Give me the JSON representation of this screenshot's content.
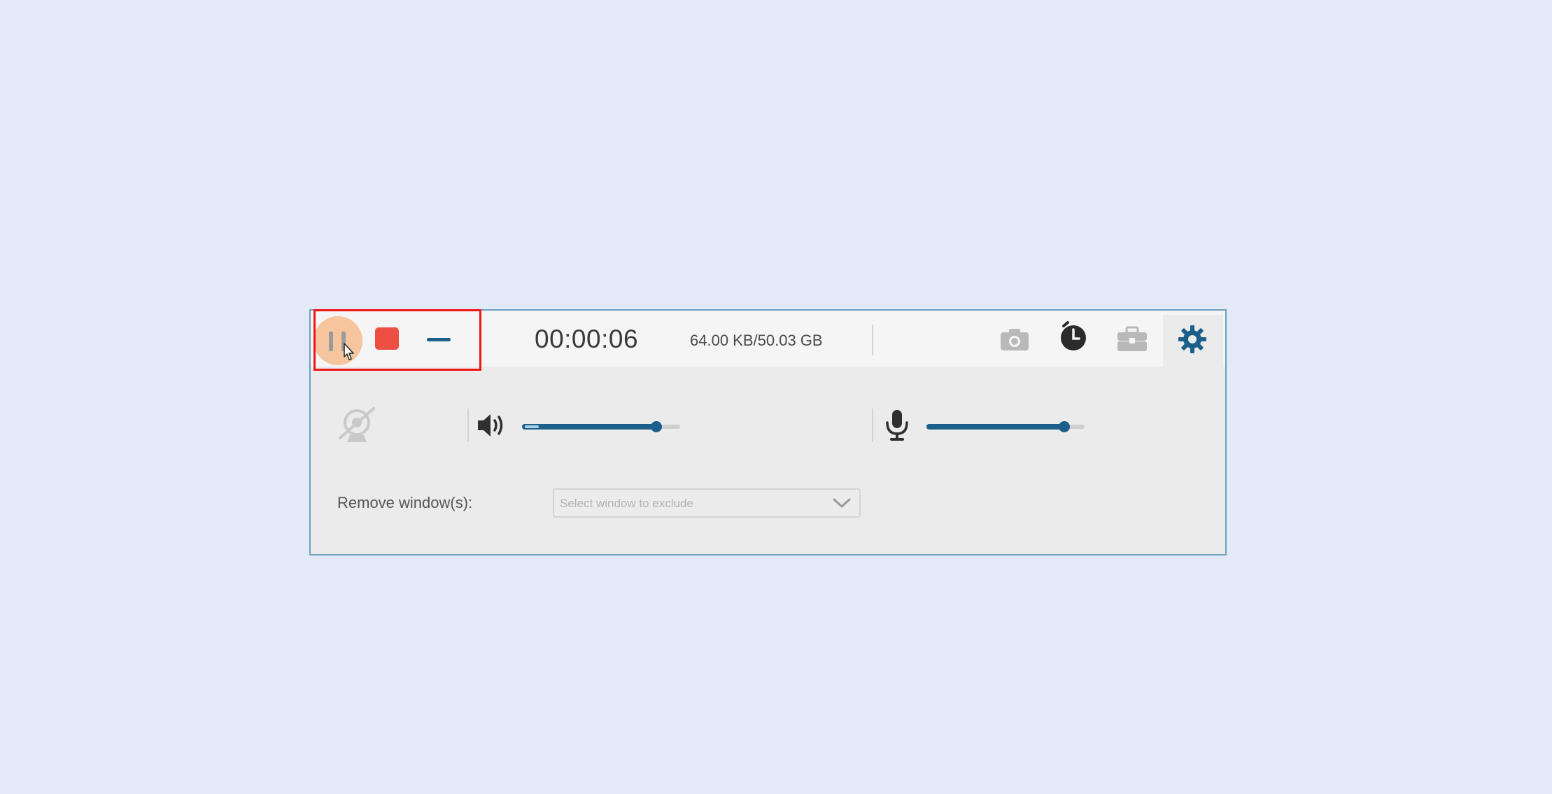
{
  "recording": {
    "elapsed_time": "00:00:06",
    "file_size": "64.00 KB/50.03 GB"
  },
  "audio": {
    "system_volume_level": 0.85,
    "microphone_volume_level": 0.87
  },
  "exclude_windows": {
    "label": "Remove window(s):",
    "placeholder": "Select window to exclude"
  },
  "icons": {
    "pause": "pause-icon",
    "stop": "stop-icon",
    "minimize": "minimize-icon",
    "snapshot": "camera-icon",
    "schedule": "clock-icon",
    "toolbox": "toolbox-icon",
    "settings": "gear-icon",
    "webcam": "webcam-off-icon",
    "speaker": "speaker-icon",
    "microphone": "microphone-icon"
  },
  "colors": {
    "accent": "#1b5f8a",
    "stop": "#ee4f43",
    "highlight": "#f01515",
    "hover": "#f6c59e"
  }
}
